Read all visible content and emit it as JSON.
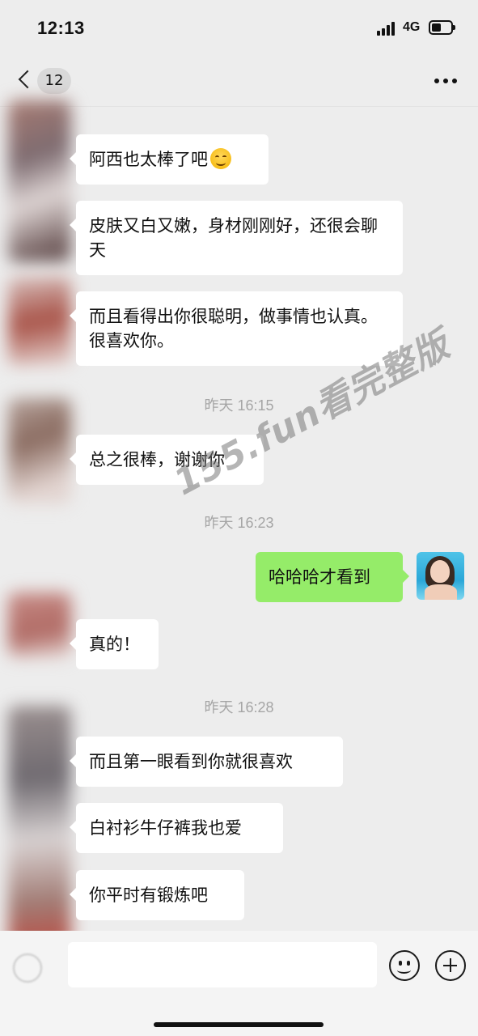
{
  "status_bar": {
    "time": "12:13",
    "network": "4G"
  },
  "nav": {
    "unread_count": "12"
  },
  "messages": [
    {
      "text": "阿西也太棒了吧",
      "emoji": "smiling-face-emoji"
    },
    {
      "text": "皮肤又白又嫩，身材刚刚好，还很会聊天"
    },
    {
      "text": "而且看得出你很聪明，做事情也认真。很喜欢你。"
    },
    {
      "time": "昨天 16:15"
    },
    {
      "text": "总之很棒，谢谢你"
    },
    {
      "time": "昨天 16:23"
    },
    {
      "text": "哈哈哈才看到",
      "mine": true
    },
    {
      "text": "真的！"
    },
    {
      "time": "昨天 16:28"
    },
    {
      "text": "而且第一眼看到你就很喜欢"
    },
    {
      "text": "白衬衫牛仔裤我也爱"
    },
    {
      "text": "你平时有锻炼吧"
    }
  ],
  "watermark": "155.fun看完整版",
  "input": {
    "value": ""
  },
  "colors": {
    "background": "#ededed",
    "my_bubble": "#95ec69",
    "their_bubble": "#ffffff",
    "timestamp": "#a5a5a5"
  }
}
